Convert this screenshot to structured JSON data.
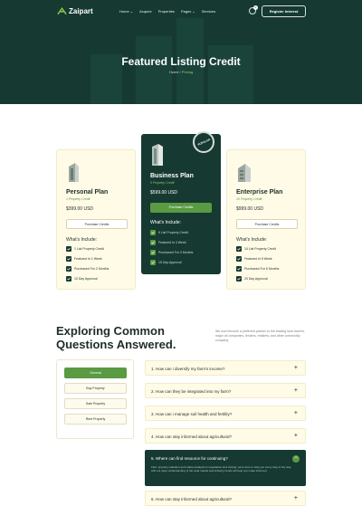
{
  "brand": {
    "name": "Zaipart"
  },
  "nav": {
    "items": [
      "Home",
      "Acquire",
      "Properties",
      "Pages",
      "Services"
    ],
    "cart_count": "0",
    "register_label": "Register Interest"
  },
  "hero": {
    "title": "Featured Listing Credit",
    "breadcrumb_home": "Home",
    "breadcrumb_current": "Pricing"
  },
  "plans": [
    {
      "name": "Personal Plan",
      "subtitle": "1 Property Credit",
      "price": "$399.00 USD",
      "button": "Purchase Credits",
      "includes_label": "What's Include:",
      "features": [
        "1 List Property Credit",
        "Featured In 1 Week",
        "Purchased For 2 Months",
        "10 Day Approval"
      ]
    },
    {
      "name": "Business Plan",
      "subtitle": "5 Property Credit",
      "price": "$599.00 USD",
      "button": "Purchase Credits",
      "includes_label": "What's Include:",
      "features": [
        "5 List Property Credit",
        "Featured In 4 Week",
        "Purchased For 3 Months",
        "15 Day Approval"
      ],
      "badge": "POPULAR"
    },
    {
      "name": "Enterprise Plan",
      "subtitle": "10 Property Credit",
      "price": "$999.00 USD",
      "button": "Purchase Credits",
      "includes_label": "What's Include:",
      "features": [
        "10 List Property Credit",
        "Featured In 5 Week",
        "Purchased For 5 Months",
        "20 Day Approval"
      ]
    }
  ],
  "faq": {
    "heading": "Exploring Common Questions Answered.",
    "description": "We now become a preferred partner to the leading land owners, major oil companies, lenders, retailers, and other commodity company.",
    "categories": [
      "General",
      "Buy Property",
      "Sale Property",
      "Rent Property"
    ],
    "questions": [
      "1. How can i diversify my farm's income?",
      "2. How can they be integrated into my farm?",
      "3. How can i manage soil health and fertility?",
      "4. How can stay informed about agricultural?",
      "5. Where can find resource for continuing?",
      "6. How can stay informed about agricultural?"
    ],
    "open_answer": "Farm property valuation and market analysis to negotiation and closing, we're here to help you every step of the way. with our deep understanding of the local market and industry trends will help you make informed."
  },
  "colors": {
    "primary": "#163a31",
    "accent": "#5a9a43",
    "card_bg": "#fffbe6"
  }
}
